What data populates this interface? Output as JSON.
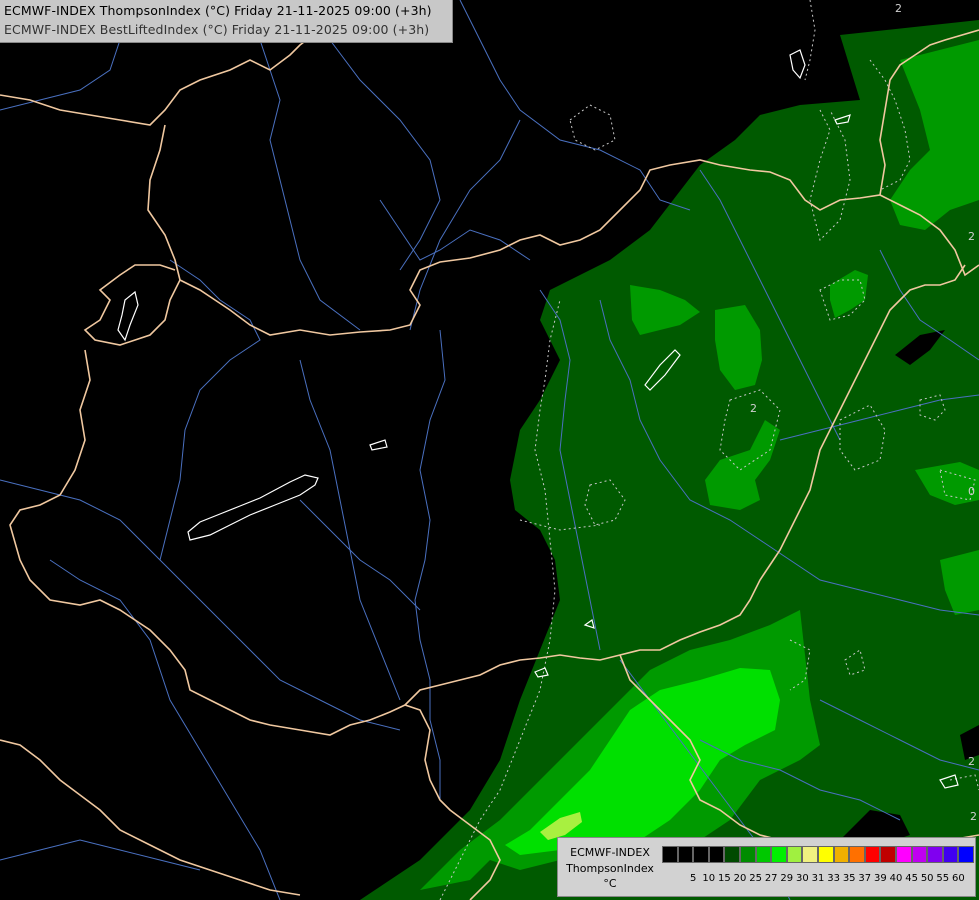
{
  "header": {
    "line1": "ECMWF-INDEX ThompsonIndex (°C) Friday 21-11-2025 09:00 (+3h)",
    "line2": "ECMWF-INDEX BestLiftedIndex (°C) Friday 21-11-2025 09:00 (+3h)"
  },
  "legend": {
    "title_line1": "ECMWF-INDEX",
    "title_line2": "ThompsonIndex",
    "title_line3": "°C",
    "colors": [
      "#000000",
      "#000000",
      "#000000",
      "#000000",
      "#004a00",
      "#008c00",
      "#00c800",
      "#00f000",
      "#a0f040",
      "#f0f080",
      "#ffff00",
      "#f0b000",
      "#ff7000",
      "#ff0000",
      "#c00000",
      "#ff00ff",
      "#c000f0",
      "#8000f0",
      "#4000f0",
      "#0000ff"
    ],
    "ticks": [
      "5",
      "10",
      "15",
      "20",
      "25",
      "27",
      "29",
      "30",
      "31",
      "33",
      "35",
      "37",
      "39",
      "40",
      "45",
      "50",
      "55",
      "60"
    ]
  },
  "map": {
    "background": "#000000",
    "border_color": "#f0c8a0",
    "river_color": "#4a70c0",
    "contour_labels": [
      "2",
      "2",
      "2",
      "2",
      "0",
      "2",
      "2"
    ]
  }
}
